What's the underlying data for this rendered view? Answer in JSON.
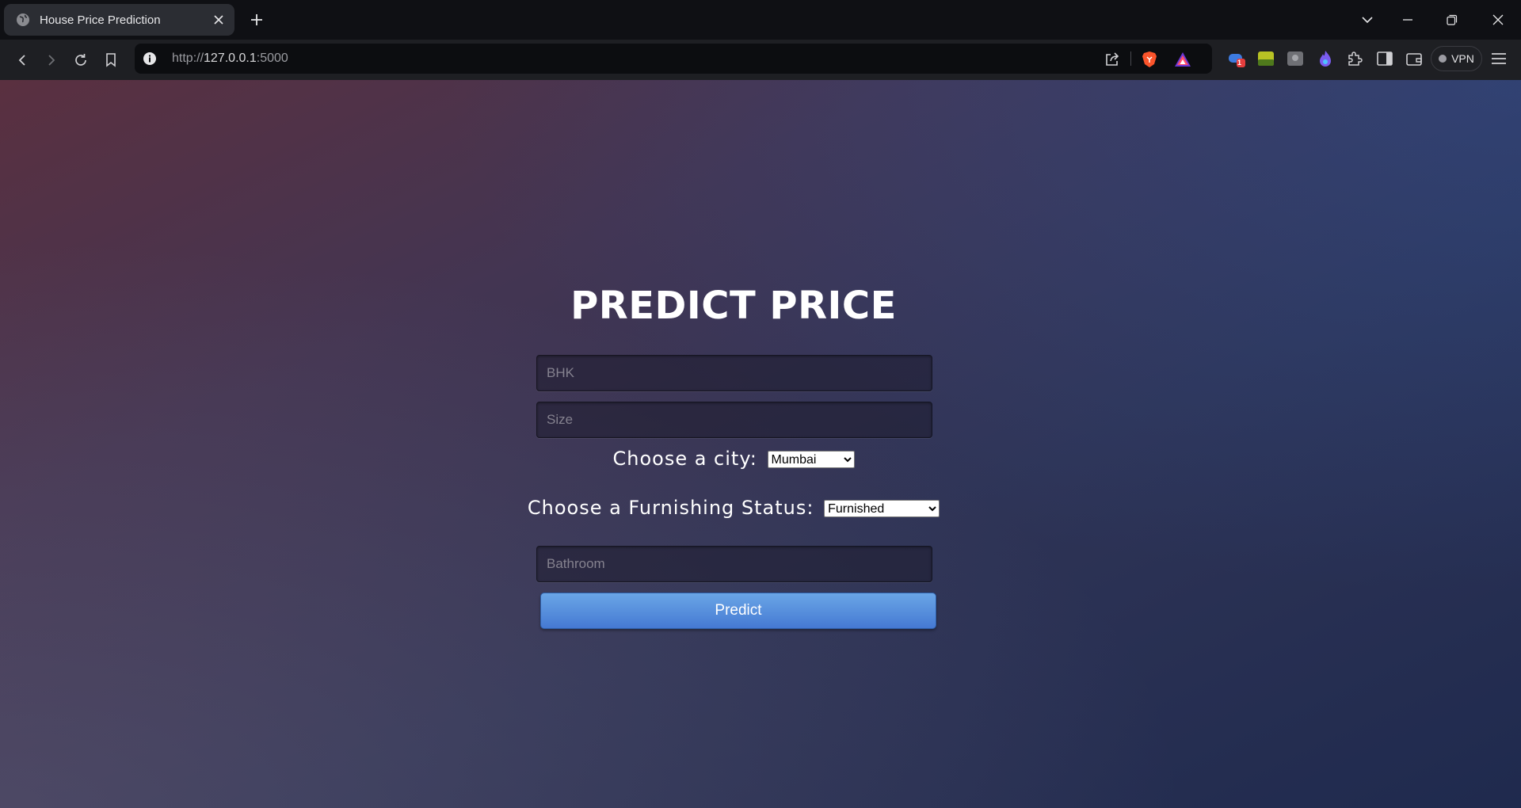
{
  "browser": {
    "tab": {
      "title": "House Price Prediction"
    },
    "url": {
      "scheme": "http://",
      "host": "127.0.0.1",
      "port": ":5000"
    },
    "vpn_label": "VPN",
    "extension_badge": "1"
  },
  "page": {
    "heading": "PREDICT PRICE",
    "bhk": {
      "placeholder": "BHK",
      "value": ""
    },
    "size": {
      "placeholder": "Size",
      "value": ""
    },
    "city": {
      "label": "Choose a city:",
      "selected": "Mumbai"
    },
    "furnishing": {
      "label": "Choose a Furnishing Status:",
      "selected": "Furnished"
    },
    "bathroom": {
      "placeholder": "Bathroom",
      "value": ""
    },
    "predict_label": "Predict"
  },
  "colors": {
    "button": "#4f86d9",
    "page_bg_start": "#5a3040",
    "page_bg_end": "#1f2a4e"
  }
}
